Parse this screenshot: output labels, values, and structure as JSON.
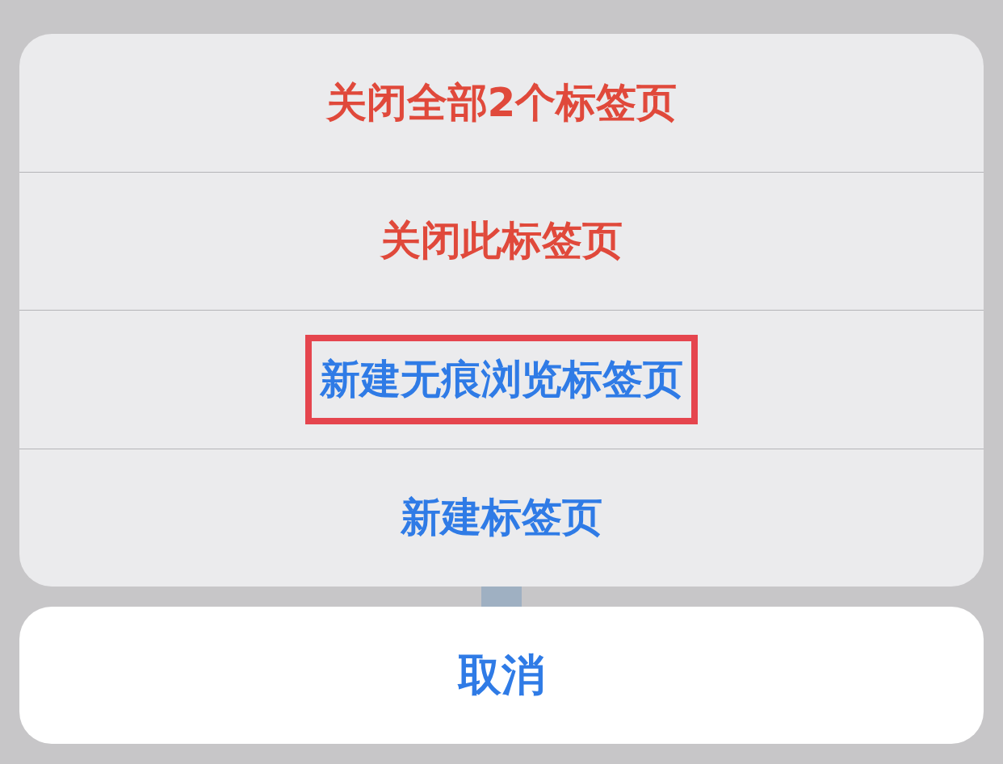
{
  "action_sheet": {
    "items": [
      {
        "label": "关闭全部2个标签页",
        "kind": "destructive",
        "highlighted": false
      },
      {
        "label": "关闭此标签页",
        "kind": "destructive",
        "highlighted": false
      },
      {
        "label": "新建无痕浏览标签页",
        "kind": "default",
        "highlighted": true
      },
      {
        "label": "新建标签页",
        "kind": "default",
        "highlighted": false
      }
    ]
  },
  "cancel_button": {
    "label": "取消"
  }
}
